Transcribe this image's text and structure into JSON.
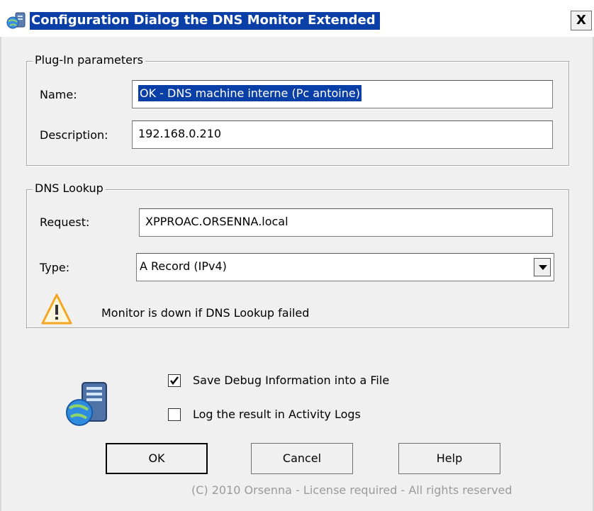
{
  "window": {
    "title": "Configuration Dialog the DNS Monitor Extended",
    "close_glyph": "X",
    "title_icon": "server-globe-icon"
  },
  "plugin_group": {
    "legend": "Plug-In parameters",
    "name_label": "Name:",
    "name_value": "OK - DNS machine interne (Pc antoine)",
    "description_label": "Description:",
    "description_value": "192.168.0.210"
  },
  "dns_group": {
    "legend": "DNS Lookup",
    "request_label": "Request:",
    "request_value": "XPPROAC.ORSENNA.local",
    "type_label": "Type:",
    "type_value": "A Record (IPv4)",
    "warning_icon": "warning-icon",
    "warning_text": "Monitor is down if DNS Lookup failed"
  },
  "options": {
    "debug_label": "Save Debug Information into a File",
    "debug_checked": true,
    "log_label": "Log the result in Activity Logs",
    "log_checked": false,
    "side_icon": "server-globe-icon"
  },
  "buttons": {
    "ok": "OK",
    "cancel": "Cancel",
    "help": "Help"
  },
  "footer": "(C) 2010 Orsenna - License required - All rights reserved",
  "colors": {
    "title_highlight": "#0a3fa8",
    "selection": "#0a3fa8",
    "dialog_bg": "#f0f0f0",
    "warning": "#f5a623"
  }
}
